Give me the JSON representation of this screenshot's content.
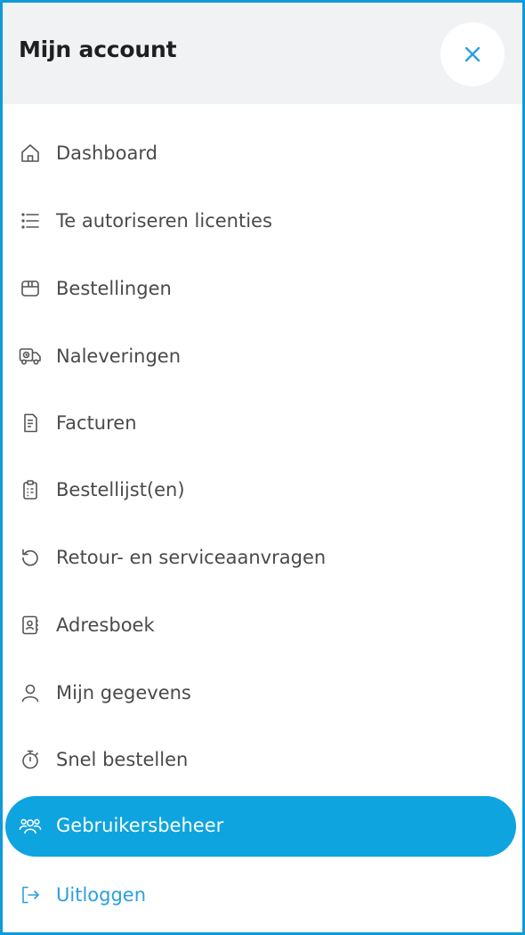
{
  "header": {
    "title": "Mijn account"
  },
  "menu": {
    "items": [
      {
        "label": "Dashboard",
        "icon": "home-icon"
      },
      {
        "label": "Te autoriseren licenties",
        "icon": "list-icon"
      },
      {
        "label": "Bestellingen",
        "icon": "box-icon"
      },
      {
        "label": "Naleveringen",
        "icon": "delivery-truck-icon"
      },
      {
        "label": "Facturen",
        "icon": "invoice-icon"
      },
      {
        "label": "Bestellijst(en)",
        "icon": "clipboard-icon"
      },
      {
        "label": "Retour- en serviceaanvragen",
        "icon": "return-arrow-icon"
      },
      {
        "label": "Adresboek",
        "icon": "address-book-icon"
      },
      {
        "label": "Mijn gegevens",
        "icon": "user-icon"
      },
      {
        "label": "Snel bestellen",
        "icon": "stopwatch-icon"
      },
      {
        "label": "Gebruikersbeheer",
        "icon": "users-icon",
        "active": true
      },
      {
        "label": "Uitloggen",
        "icon": "logout-icon"
      }
    ]
  },
  "colors": {
    "accent": "#0ea4df",
    "frame_border": "#0f9ad8",
    "header_bg": "#f1f2f4",
    "text": "#4a4a4a",
    "logout_text": "#2b9fe0"
  }
}
